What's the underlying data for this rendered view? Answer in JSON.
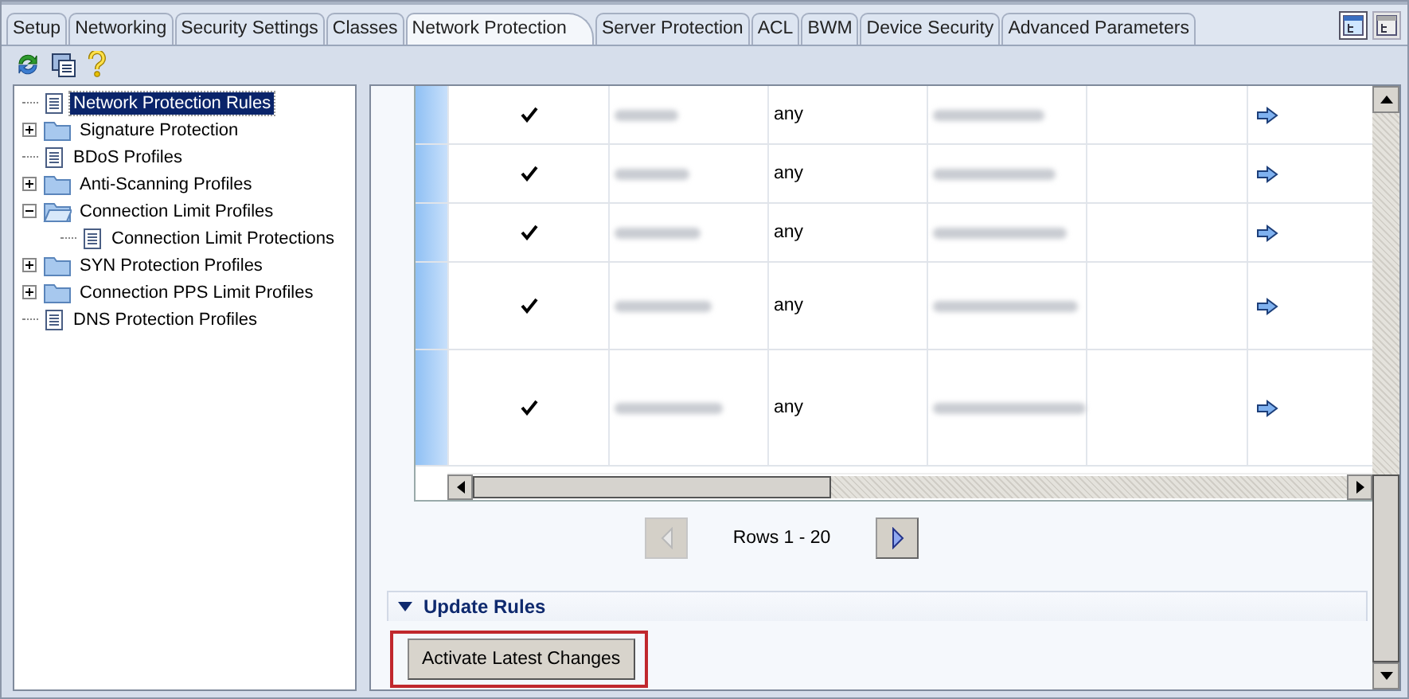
{
  "tabs": [
    {
      "label": "Setup",
      "selected": false
    },
    {
      "label": "Networking",
      "selected": false
    },
    {
      "label": "Security Settings",
      "selected": false
    },
    {
      "label": "Classes",
      "selected": false
    },
    {
      "label": "Network Protection",
      "selected": true
    },
    {
      "label": "Server Protection",
      "selected": false
    },
    {
      "label": "ACL",
      "selected": false
    },
    {
      "label": "BWM",
      "selected": false
    },
    {
      "label": "Device Security",
      "selected": false
    },
    {
      "label": "Advanced Parameters",
      "selected": false
    }
  ],
  "view_buttons": [
    {
      "selected": true
    },
    {
      "selected": false
    }
  ],
  "tree": [
    {
      "label": "Network Protection Rules",
      "kind": "rules",
      "selected": true
    },
    {
      "label": "Signature Protection",
      "kind": "folder",
      "expanded": false,
      "selected": false
    },
    {
      "label": "BDoS Profiles",
      "kind": "rules",
      "selected": false
    },
    {
      "label": "Anti-Scanning Profiles",
      "kind": "folder",
      "expanded": false,
      "selected": false
    },
    {
      "label": "Connection Limit Profiles",
      "kind": "folder",
      "expanded": true,
      "selected": false,
      "children": [
        {
          "label": "Connection Limit Protections",
          "kind": "rules",
          "selected": false
        }
      ]
    },
    {
      "label": "SYN Protection Profiles",
      "kind": "folder",
      "expanded": false,
      "selected": false
    },
    {
      "label": "Connection PPS Limit Profiles",
      "kind": "folder",
      "expanded": false,
      "selected": false
    },
    {
      "label": "DNS Protection Profiles",
      "kind": "rules",
      "selected": false
    }
  ],
  "table": {
    "rows": [
      {
        "cells": [
          {
            "kind": "check",
            "checked": true
          },
          {
            "kind": "redacted"
          },
          {
            "kind": "text",
            "text": "any"
          },
          {
            "kind": "redacted"
          },
          {
            "kind": "blank"
          },
          {
            "kind": "link"
          }
        ]
      },
      {
        "cells": [
          {
            "kind": "check",
            "checked": true
          },
          {
            "kind": "redacted"
          },
          {
            "kind": "text",
            "text": "any"
          },
          {
            "kind": "redacted"
          },
          {
            "kind": "blank"
          },
          {
            "kind": "link"
          }
        ]
      },
      {
        "cells": [
          {
            "kind": "check",
            "checked": true
          },
          {
            "kind": "redacted"
          },
          {
            "kind": "text",
            "text": "any"
          },
          {
            "kind": "redacted"
          },
          {
            "kind": "blank"
          },
          {
            "kind": "link"
          }
        ]
      },
      {
        "cells": [
          {
            "kind": "check",
            "checked": true
          },
          {
            "kind": "redacted"
          },
          {
            "kind": "text",
            "text": "any"
          },
          {
            "kind": "redacted"
          },
          {
            "kind": "blank"
          },
          {
            "kind": "link"
          }
        ]
      },
      {
        "cells": [
          {
            "kind": "check",
            "checked": true
          },
          {
            "kind": "redacted"
          },
          {
            "kind": "text",
            "text": "any"
          },
          {
            "kind": "redacted"
          },
          {
            "kind": "blank"
          },
          {
            "kind": "link"
          }
        ]
      }
    ]
  },
  "pager": {
    "previous_disabled": true,
    "label": "Rows 1 - 20",
    "next_disabled": false
  },
  "section": {
    "title": "Update Rules",
    "expanded": true,
    "button": {
      "label": "Activate Latest Changes",
      "highlighted": true
    }
  }
}
